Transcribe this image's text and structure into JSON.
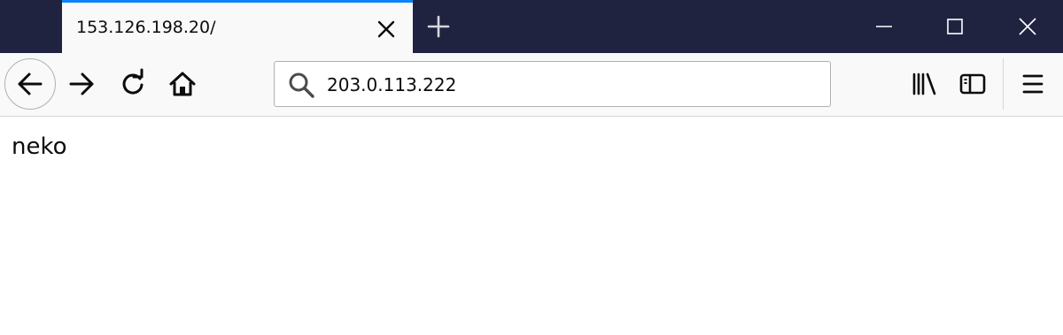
{
  "browser": {
    "tab": {
      "title": "153.126.198.20/"
    },
    "urlbar": {
      "value": "203.0.113.222"
    },
    "icons": {
      "tab_close": "close-icon",
      "new_tab": "plus-icon",
      "minimize": "minimize-icon",
      "maximize": "maximize-icon",
      "close_window": "close-icon",
      "back": "arrow-left-icon",
      "forward": "arrow-right-icon",
      "reload": "reload-icon",
      "home": "home-icon",
      "search": "search-icon",
      "library": "library-icon",
      "sidebar": "sidebar-icon",
      "menu": "hamburger-menu-icon"
    },
    "colors": {
      "titlebar": "#202340",
      "active_tab_accent": "#0a84ff",
      "toolbar": "#f9f9fa"
    }
  },
  "page": {
    "body_text": "neko"
  }
}
